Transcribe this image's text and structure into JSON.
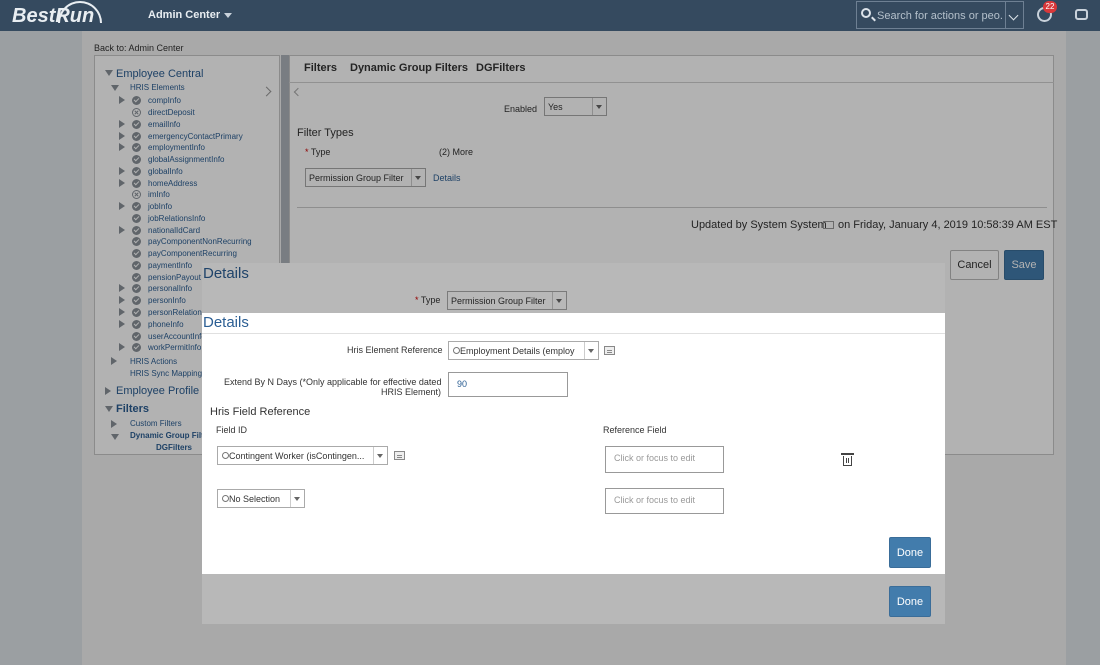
{
  "shell": {
    "logo": "BestRun",
    "app_name": "Admin Center",
    "search_placeholder": "Search for actions or peo...",
    "notification_count": "22"
  },
  "page": {
    "back_link": "Back to: Admin Center",
    "tabs": [
      "Filters",
      "Dynamic Group Filters",
      "DGFilters"
    ],
    "enabled_label": "Enabled",
    "enabled_value": "Yes",
    "filter_types_heading": "Filter Types",
    "type_label": "Type",
    "more_label": "(2) More",
    "filter_type_value": "Permission Group Filter",
    "details_link": "Details",
    "updated_text": "Updated by System System",
    "updated_date": "on Friday, January 4, 2019 10:58:39 AM EST",
    "cancel_label": "Cancel",
    "save_label": "Save"
  },
  "tree": {
    "sections": [
      "Employee Central",
      "Employee Profile",
      "Filters"
    ],
    "hris_elements_label": "HRIS Elements",
    "items": [
      "compInfo",
      "directDeposit",
      "emailInfo",
      "emergencyContactPrimary",
      "employmentInfo",
      "globalAssignmentInfo",
      "globalInfo",
      "homeAddress",
      "imInfo",
      "jobInfo",
      "jobRelationsInfo",
      "nationalIdCard",
      "payComponentNonRecurring",
      "payComponentRecurring",
      "paymentInfo",
      "pensionPayout",
      "personalInfo",
      "personInfo",
      "personRelation",
      "phoneInfo",
      "userAccountInfo",
      "workPermitInfo"
    ],
    "hris_actions": "HRIS Actions",
    "hris_sync": "HRIS Sync Mapping",
    "custom_filters": "Custom Filters",
    "dynamic_group": "Dynamic Group Filters",
    "dgfilters": "DGFilters"
  },
  "dialog_outer": {
    "title": "Details",
    "type_label": "Type",
    "type_value": "Permission Group Filter",
    "done_label": "Done"
  },
  "dialog_inner": {
    "title": "Details",
    "hris_element_label": "Hris Element Reference",
    "hris_element_value": "Employment Details (employ",
    "extend_label_1": "Extend By N Days (*Only applicable for effective dated",
    "extend_label_2": "HRIS Element)",
    "extend_value": "90",
    "field_ref_heading": "Hris Field Reference",
    "field_id_header": "Field ID",
    "reference_field_header": "Reference Field",
    "row1_field_id": "Contingent Worker (isContingen...",
    "row1_ref_placeholder": "Click or focus to edit",
    "row2_field_id": "No Selection",
    "row2_ref_placeholder": "Click or focus to edit",
    "done_label": "Done"
  }
}
